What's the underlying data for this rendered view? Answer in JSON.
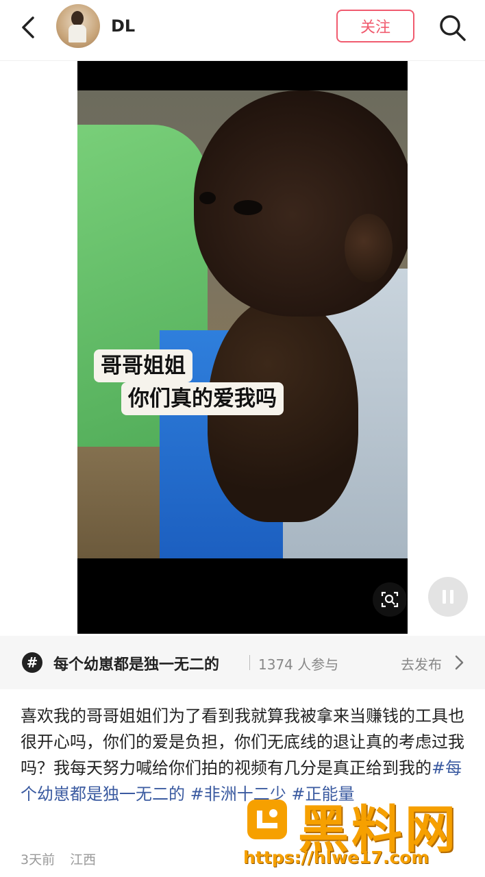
{
  "header": {
    "username": "DL",
    "follow_label": "关注"
  },
  "video": {
    "caption_line1": "哥哥姐姐",
    "caption_line2": "你们真的爱我吗"
  },
  "topic": {
    "name": "每个幼崽都是独一无二的",
    "participants": "1374 人参与",
    "action": "去发布"
  },
  "post": {
    "text": "喜欢我的哥哥姐姐们为了看到我就算我被拿来当赚钱的工具也很开心吗，你们的爱是负担，你们无底线的退让真的考虑过我吗？我每天努力喊给你们拍的视频有几分是真正给到我的",
    "tags": [
      "#每个幼崽都是独一无二的",
      "#非洲十二少",
      "#正能量"
    ],
    "time": "3天前",
    "location": "江西"
  },
  "watermark": {
    "title": "黑料网",
    "url": "https://hlwe17.com"
  },
  "colors": {
    "follow": "#f05a6e",
    "tag": "#3a5aa0",
    "watermark": "#f6a000"
  }
}
